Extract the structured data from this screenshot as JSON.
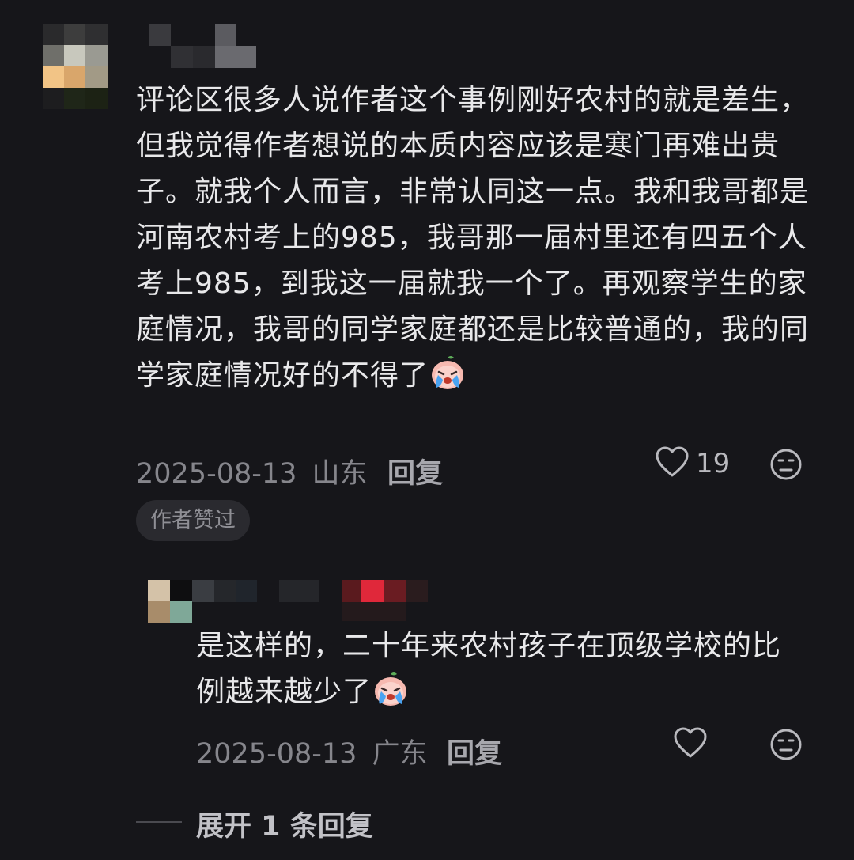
{
  "comment": {
    "text": "评论区很多人说作者这个事例刚好农村的就是差生，但我觉得作者想说的本质内容应该是寒门再难出贵子。就我个人而言，非常认同这一点。我和我哥都是河南农村考上的985，我哥那一届村里还有四五个人考上985，到我这一届就我一个了。再观察学生的家庭情况，我哥的同学家庭都还是比较普通的，我的同学家庭情况好的不得了",
    "emoji": "crying-face-icon",
    "date": "2025-08-13",
    "location": "山东",
    "reply_label": "回复",
    "like_count": "19",
    "author_liked_badge": "作者赞过"
  },
  "reply": {
    "text": "是这样的，二十年来农村孩子在顶级学校的比例越来越少了",
    "emoji": "crying-face-icon",
    "date": "2025-08-13",
    "location": "广东",
    "reply_label": "回复"
  },
  "expand_replies_label": "展开 1 条回复",
  "colors": {
    "background": "#16161a",
    "text": "#e8e8ea",
    "meta": "#86868c"
  }
}
